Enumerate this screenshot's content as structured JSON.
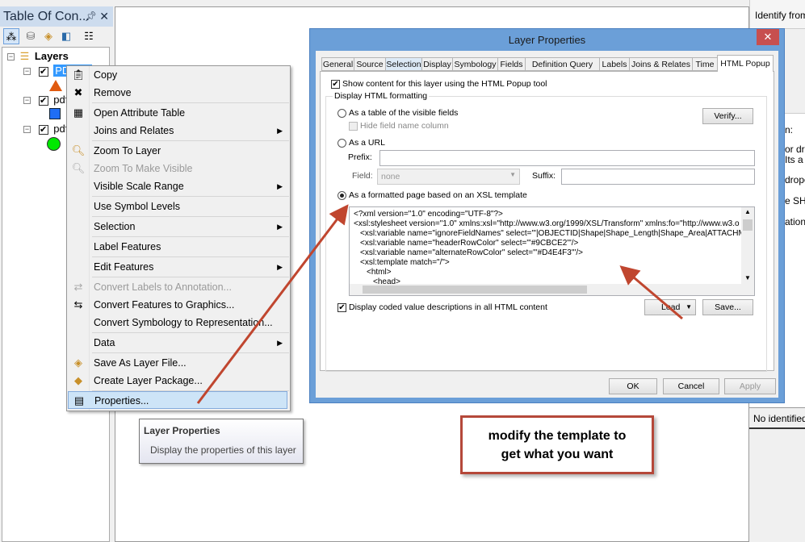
{
  "toc": {
    "title": "Table Of Con...",
    "pin_icon": "pin-icon",
    "close_icon": "close-icon",
    "toolbar": [
      "list-by-drawing-order-icon",
      "list-by-source-icon",
      "list-by-visibility-icon",
      "list-by-selection-icon",
      "options-icon"
    ],
    "root": "Layers",
    "layers": [
      {
        "name": "PDF",
        "symbol": "triangle",
        "color": "#e05a10",
        "checked": true,
        "selected": true
      },
      {
        "name": "pdf",
        "symbol": "square",
        "color": "#1f6ef5",
        "checked": true
      },
      {
        "name": "pdf",
        "symbol": "circle",
        "color": "#00e800",
        "checked": true
      }
    ]
  },
  "context_menu": {
    "items": [
      {
        "label": "Copy",
        "icon": "copy-icon"
      },
      {
        "label": "Remove",
        "icon": "remove-icon"
      },
      {
        "label": "Open Attribute Table",
        "icon": "table-icon"
      },
      {
        "label": "Joins and Relates",
        "submenu": true
      },
      {
        "label": "Zoom To Layer",
        "icon": "zoom-to-layer-icon"
      },
      {
        "label": "Zoom To Make Visible",
        "icon": "zoom-visible-icon",
        "disabled": true
      },
      {
        "label": "Visible Scale Range",
        "submenu": true
      },
      {
        "label": "Use Symbol Levels"
      },
      {
        "label": "Selection",
        "submenu": true
      },
      {
        "label": "Label Features"
      },
      {
        "label": "Edit Features",
        "submenu": true
      },
      {
        "label": "Convert Labels to Annotation...",
        "icon": "convert-labels-icon",
        "disabled": true
      },
      {
        "label": "Convert Features to Graphics...",
        "icon": "convert-graphics-icon"
      },
      {
        "label": "Convert Symbology to Representation..."
      },
      {
        "label": "Data",
        "submenu": true
      },
      {
        "label": "Save As Layer File...",
        "icon": "save-layer-icon"
      },
      {
        "label": "Create Layer Package...",
        "icon": "layer-package-icon"
      },
      {
        "label": "Properties...",
        "icon": "properties-icon",
        "highlighted": true
      }
    ]
  },
  "tooltip": {
    "title": "Layer Properties",
    "text": "Display the properties of this layer"
  },
  "dialog": {
    "title": "Layer Properties",
    "tabs": [
      "General",
      "Source",
      "Selection",
      "Display",
      "Symbology",
      "Fields",
      "Definition Query",
      "Labels",
      "Joins & Relates",
      "Time",
      "HTML Popup"
    ],
    "active_tab": "HTML Popup",
    "show_content_label": "Show content for this layer using the HTML Popup tool",
    "show_content_checked": true,
    "group_label": "Display HTML formatting",
    "radio_table": "As a table of the visible fields",
    "hide_field_label": "Hide field name column",
    "verify_button": "Verify...",
    "radio_url": "As a URL",
    "prefix_label": "Prefix:",
    "prefix_value": "",
    "field_label": "Field:",
    "field_value": "none",
    "suffix_label": "Suffix:",
    "suffix_value": "",
    "radio_xsl": "As a formatted page based on an XSL template",
    "selected_radio": "xsl",
    "code_lines": [
      "<?xml version=\"1.0\" encoding=\"UTF-8\"?>",
      "<xsl:stylesheet version=\"1.0\" xmlns:xsl=\"http://www.w3.org/1999/XSL/Transform\" xmlns:fo=\"http://www.w3.o",
      "  <xsl:variable name=\"ignoreFieldNames\" select=\"'|OBJECTID|Shape|Shape_Length|Shape_Area|ATTACHMENTI",
      "  <xsl:variable name=\"headerRowColor\" select=\"'#9CBCE2'\"/>",
      "  <xsl:variable name=\"alternateRowColor\" select=\"'#D4E4F3'\"/>",
      "  <xsl:template match=\"/\">",
      "    <html>",
      "      <head>"
    ],
    "coded_values_label": "Display coded value descriptions in all HTML content",
    "coded_values_checked": true,
    "load_button": "Load",
    "save_button": "Save...",
    "ok_button": "OK",
    "cancel_button": "Cancel",
    "apply_button": "Apply"
  },
  "right_panel": {
    "identify_from": "Identify from",
    "fragments": [
      "n:",
      "or dra",
      "Its a",
      "dropo",
      "e SHI",
      "ation"
    ],
    "status": "No identified"
  },
  "annotation": {
    "line1": "modify the template to",
    "line2": "get what you want",
    "color": "#b5483a"
  }
}
